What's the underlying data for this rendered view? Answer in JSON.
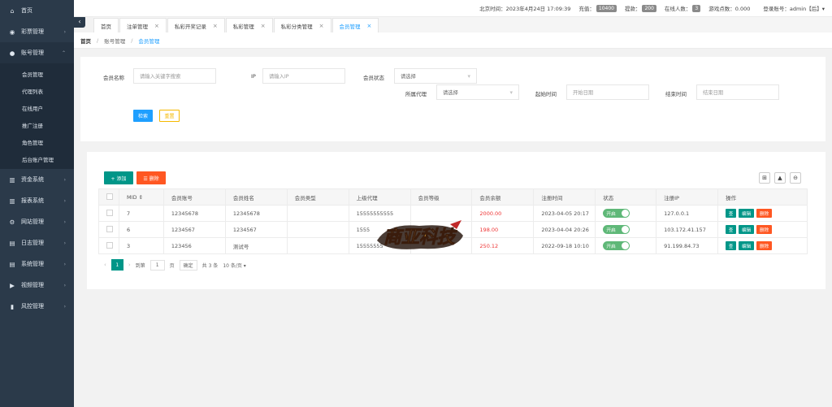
{
  "sidebar": {
    "items": [
      {
        "icon": "home-icon",
        "glyph": "⌂",
        "label": "首页",
        "caret": ""
      },
      {
        "icon": "gamepad-icon",
        "glyph": "◉",
        "label": "彩票管理",
        "caret": "›"
      },
      {
        "icon": "user-icon",
        "glyph": "●",
        "label": "账号管理",
        "caret": "⌃"
      }
    ],
    "submenu": [
      "会员管理",
      "代理列表",
      "在线用户",
      "推广注册",
      "角色管理",
      "后台账户管理"
    ],
    "items_after": [
      {
        "icon": "bank-icon",
        "glyph": "▥",
        "label": "资金系统",
        "caret": "›"
      },
      {
        "icon": "report-icon",
        "glyph": "▥",
        "label": "报表系统",
        "caret": "›"
      },
      {
        "icon": "gear-icon",
        "glyph": "⚙",
        "label": "网站管理",
        "caret": "›"
      },
      {
        "icon": "log-icon",
        "glyph": "▤",
        "label": "日志管理",
        "caret": "›"
      },
      {
        "icon": "system-icon",
        "glyph": "▤",
        "label": "系统管理",
        "caret": "›"
      },
      {
        "icon": "video-icon",
        "glyph": "▶",
        "label": "视频管理",
        "caret": "›"
      },
      {
        "icon": "chart-icon",
        "glyph": "▮",
        "label": "风控管理",
        "caret": "›"
      }
    ]
  },
  "topbar": {
    "time_label": "北京时间：2023年4月24日 17:09:39",
    "recharge_label": "充值：",
    "recharge_value": "10400",
    "withdraw_label": "提款：",
    "withdraw_value": "200",
    "online_label": "在线人数：",
    "online_value": "3",
    "game_points": "游戏点数：0.000",
    "user": "登录账号：admin【后】▾"
  },
  "tabs": [
    {
      "label": "首页",
      "closable": false,
      "active": false
    },
    {
      "label": "注单管理",
      "closable": true,
      "active": false
    },
    {
      "label": "私彩开奖记录",
      "closable": true,
      "active": false
    },
    {
      "label": "私彩管理",
      "closable": true,
      "active": false
    },
    {
      "label": "私彩分类管理",
      "closable": true,
      "active": false
    },
    {
      "label": "会员管理",
      "closable": true,
      "active": true
    }
  ],
  "breadcrumb": {
    "home": "首页",
    "parent": "账号管理",
    "current": "会员管理"
  },
  "search": {
    "member_name_label": "会员名称",
    "member_name_placeholder": "请输入关键字搜索",
    "ip_label": "IP",
    "ip_placeholder": "请输入IP",
    "status_label": "会员状态",
    "status_value": "请选择",
    "agent_label": "所属代理",
    "agent_value": "请选择",
    "start_label": "起始时间",
    "start_placeholder": "开始日期",
    "end_label": "结束时间",
    "end_placeholder": "结束日期",
    "search_btn": "检索",
    "reset_btn": "重置"
  },
  "toolbar": {
    "add": "+ 添加",
    "delete": "☰ 删除",
    "icons": [
      "columns-icon",
      "print-icon",
      "export-icon"
    ]
  },
  "table": {
    "headers": [
      "MID ⇕",
      "会员账号",
      "会员姓名",
      "会员类型",
      "上级代理",
      "会员等级",
      "会员余额",
      "注册时间",
      "状态",
      "注册IP",
      "操作"
    ],
    "rows": [
      {
        "mid": "7",
        "account": "12345678",
        "name": "12345678",
        "type": "",
        "agent": "15555555555",
        "level": "",
        "balance": "2000.00",
        "reg_time": "2023-04-05 20:17",
        "status": "开启",
        "ip": "127.0.0.1"
      },
      {
        "mid": "6",
        "account": "1234567",
        "name": "1234567",
        "type": "",
        "agent": "1555",
        "level": "",
        "balance": "198.00",
        "reg_time": "2023-04-04 20:26",
        "status": "开启",
        "ip": "103.172.41.157"
      },
      {
        "mid": "3",
        "account": "123456",
        "name": "测试号",
        "type": "",
        "agent": "15555555",
        "level": "",
        "balance": "250.12",
        "reg_time": "2022-09-18 10:10",
        "status": "开启",
        "ip": "91.199.84.73"
      }
    ],
    "ops": {
      "view": "查",
      "edit": "编辑",
      "remove": "删除"
    }
  },
  "pager": {
    "prev": "‹",
    "current": "1",
    "next": "›",
    "goto_label": "到第",
    "goto_value": "1",
    "page_label": "页",
    "confirm": "确定",
    "total": "共 3 条",
    "size": "10 条/页 ▾"
  },
  "watermark": {
    "text": "商亚科技"
  }
}
